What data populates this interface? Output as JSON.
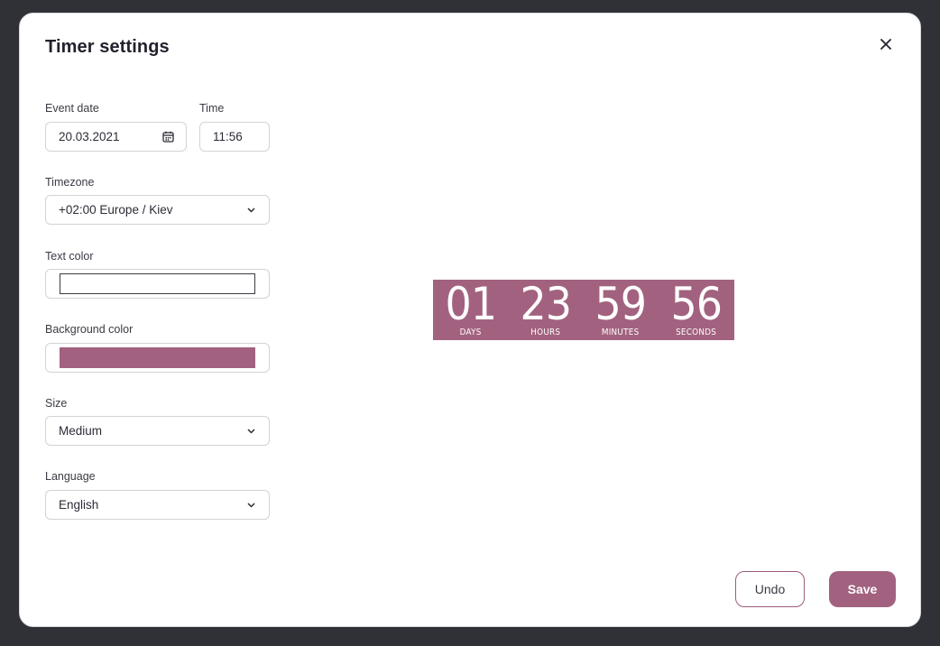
{
  "dialog": {
    "title": "Timer settings",
    "close_icon": "close-icon"
  },
  "form": {
    "event_date": {
      "label": "Event date",
      "value": "20.03.2021",
      "icon": "calendar-icon"
    },
    "time": {
      "label": "Time",
      "value": "11:56"
    },
    "timezone": {
      "label": "Timezone",
      "value": "+02:00 Europe / Kiev",
      "icon": "chevron-down-icon"
    },
    "text_color": {
      "label": "Text color",
      "value": "#ffffff"
    },
    "background_color": {
      "label": "Background color",
      "value": "#a2627f"
    },
    "size": {
      "label": "Size",
      "value": "Medium",
      "icon": "chevron-down-icon"
    },
    "language": {
      "label": "Language",
      "value": "English",
      "icon": "chevron-down-icon"
    }
  },
  "preview": {
    "units": [
      {
        "value": "01",
        "label": "DAYS"
      },
      {
        "value": "23",
        "label": "HOURS"
      },
      {
        "value": "59",
        "label": "MINUTES"
      },
      {
        "value": "56",
        "label": "SECONDS"
      }
    ]
  },
  "actions": {
    "undo_label": "Undo",
    "save_label": "Save"
  },
  "colors": {
    "accent": "#a2627f",
    "backdrop": "#2f3136"
  }
}
